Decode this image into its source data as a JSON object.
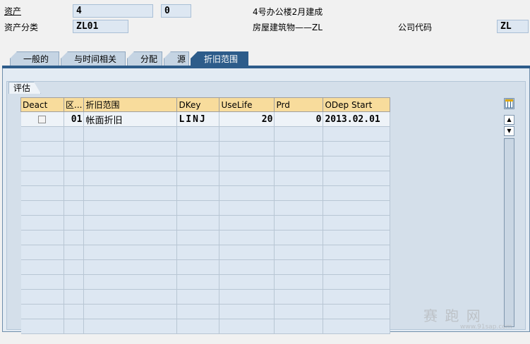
{
  "header": {
    "asset_label": "资产",
    "asset_number": "4",
    "asset_sub": "0",
    "asset_desc": "4号办公楼2月建成",
    "class_label": "资产分类",
    "class_value": "ZL01",
    "class_desc": "房屋建筑物——ZL",
    "company_label": "公司代码",
    "company_value": "ZL"
  },
  "tabs": [
    {
      "label": "一般的"
    },
    {
      "label": "与时间相关"
    },
    {
      "label": "分配"
    },
    {
      "label": "源"
    },
    {
      "label": "折旧范围",
      "active": true
    }
  ],
  "group": {
    "title": "评估"
  },
  "table": {
    "columns": [
      "Deact",
      "区...",
      "折旧范围",
      "DKey",
      "UseLife",
      "Prd",
      "ODep Start"
    ],
    "rows": [
      {
        "deact": false,
        "area": "01",
        "area_desc": "帐面折旧",
        "dkey": "LINJ",
        "uselife": "20",
        "prd": "0",
        "odep_start": "2013.02.01"
      }
    ]
  },
  "icons": {
    "table_settings": "table-settings-icon",
    "scroll_up": "triangle-up-icon",
    "scroll_down": "triangle-down-icon"
  },
  "watermark": {
    "text": "赛 跑 网",
    "url": "www.91sap.com"
  },
  "colors": {
    "active_tab": "#2d5c8a",
    "table_header": "#f8dc9c",
    "field_bg": "#dde7f2",
    "panel_bg": "#d4dfea"
  }
}
